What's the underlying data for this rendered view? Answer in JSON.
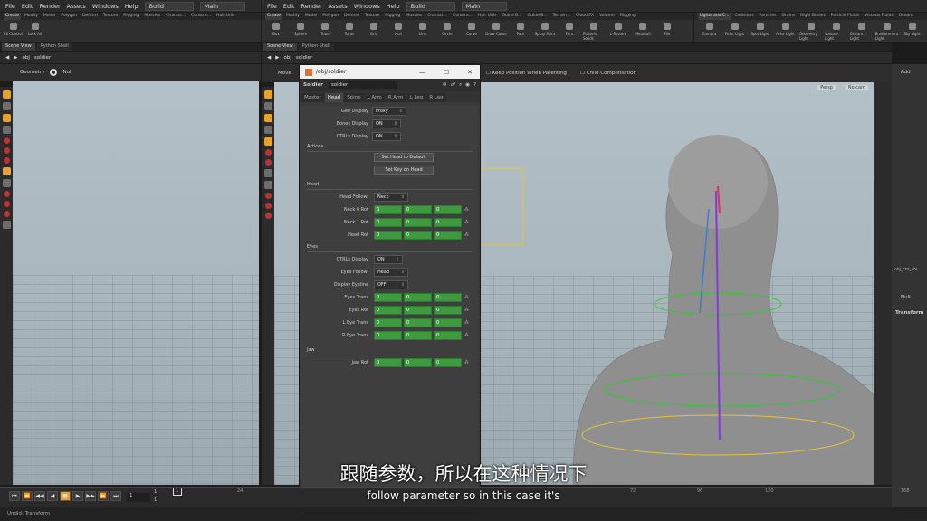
{
  "left_window": {
    "menus": [
      "File",
      "Edit",
      "Render",
      "Assets",
      "Windows",
      "Help"
    ],
    "desktop": "Build",
    "context": "Main",
    "shelf_tabs": [
      "Create",
      "Modify",
      "Model",
      "Polygon",
      "Deform",
      "Texture",
      "Rigging",
      "Muscles",
      "Charact...",
      "Constra...",
      "Hair Utils"
    ],
    "shelf_tools": [
      "FK Control",
      "Lock All"
    ],
    "pane_tabs": [
      "Scene View",
      "Python Shell"
    ],
    "path": [
      "obj",
      "soldier"
    ],
    "viewport_label": "Geometry",
    "viewport_node": "Null"
  },
  "main_window": {
    "menus": [
      "File",
      "Edit",
      "Render",
      "Assets",
      "Windows",
      "Help"
    ],
    "desktop": "Build",
    "context": "Main",
    "shelf_tabs": [
      "Create",
      "Modify",
      "Model",
      "Polygon",
      "Deform",
      "Texture",
      "Rigging",
      "Muscles",
      "Charact...",
      "Constra...",
      "Hair Utils",
      "Guide B...",
      "Guide B...",
      "Terrain...",
      "Cloud FX",
      "Volume",
      "Rigging"
    ],
    "shelf_tools": [
      "Box",
      "Sphere",
      "Tube",
      "Torus",
      "Grid",
      "Null",
      "Line",
      "Circle",
      "Curve",
      "Draw Curve",
      "Path",
      "Spray Paint",
      "Font",
      "Platonic Solids",
      "L-System",
      "Metaball",
      "File"
    ],
    "right_shelf_tabs": [
      "Lights and C...",
      "Collisions",
      "Particles",
      "Grains",
      "Rigid Bodies",
      "Particle Fluids",
      "Viscous Fluids",
      "Oceans"
    ],
    "right_shelf_tools": [
      "Camera",
      "Point Light",
      "Spot Light",
      "Area Light",
      "Geometry Light",
      "Volume Light",
      "Distant Light",
      "Environment Light",
      "Sky Light"
    ],
    "pane_tabs": [
      "Scene View",
      "Python Shell"
    ],
    "path": [
      "obj",
      "soldier"
    ],
    "viewport_tool": "Move",
    "keep_position": "Keep Position When Parenting",
    "child_comp": "Child Compensation",
    "persp": "Persp",
    "no_cam": "No cam",
    "right_panel": {
      "add": "Add",
      "path_label": "obj_ctrl_chl",
      "node": "Null",
      "tab": "Transform"
    }
  },
  "param_window": {
    "title": "/obj/soldier",
    "node_type": "Soldier",
    "node_name": "soldier",
    "tabs": [
      "Master",
      "Head",
      "Spine",
      "L Arm",
      "R Arm",
      "L Leg",
      "R Leg"
    ],
    "selected_tab": "Head",
    "geo_display": {
      "label": "Geo Display",
      "value": "Proxy"
    },
    "bones_display": {
      "label": "Bones Display",
      "value": "ON"
    },
    "ctrls_display": {
      "label": "CTRLs Display",
      "value": "ON"
    },
    "actions": {
      "title": "Actions",
      "btn1": "Set Head to Default",
      "btn2": "Set Key on Head"
    },
    "head": {
      "title": "Head",
      "follow_label": "Head Follow:",
      "follow_value": "Neck",
      "rows": [
        {
          "label": "Neck 0 Rot",
          "v": [
            "0",
            "0",
            "0"
          ]
        },
        {
          "label": "Neck 1 Rot",
          "v": [
            "0",
            "0",
            "0"
          ]
        },
        {
          "label": "Head Rot",
          "v": [
            "0",
            "0",
            "0"
          ]
        }
      ]
    },
    "eyes": {
      "title": "Eyes",
      "ctrls_label": "CTRLs Display",
      "ctrls_value": "ON",
      "follow_label": "Eyes Follow:",
      "follow_value": "Head",
      "eyeline_label": "Display Eyeline",
      "eyeline_value": "OFF",
      "rows": [
        {
          "label": "Eyes Trans",
          "v": [
            "0",
            "0",
            "0"
          ]
        },
        {
          "label": "Eyes Rot",
          "v": [
            "0",
            "0",
            "0"
          ]
        },
        {
          "label": "L Eye Trans",
          "v": [
            "0",
            "0",
            "0"
          ]
        },
        {
          "label": "R Eye Trans",
          "v": [
            "0",
            "0",
            "0"
          ]
        }
      ]
    },
    "jaw": {
      "title": "Jaw",
      "rows": [
        {
          "label": "Jaw Rot",
          "v": [
            "0",
            "0",
            "0"
          ]
        }
      ]
    }
  },
  "timeline": {
    "frame": "1",
    "start": "1",
    "end": "1",
    "ticks": [
      "24",
      "72",
      "96",
      "120",
      "168"
    ],
    "left_tick": "1"
  },
  "status": "Undid: Transform",
  "subtitle_cn": "跟随参数，所以在这种情况下",
  "subtitle_en": "follow parameter so in this case it's",
  "colors": {
    "accent": "#e7a22a",
    "param_green": "#3e9a3e",
    "bg": "#2b2b2b"
  }
}
